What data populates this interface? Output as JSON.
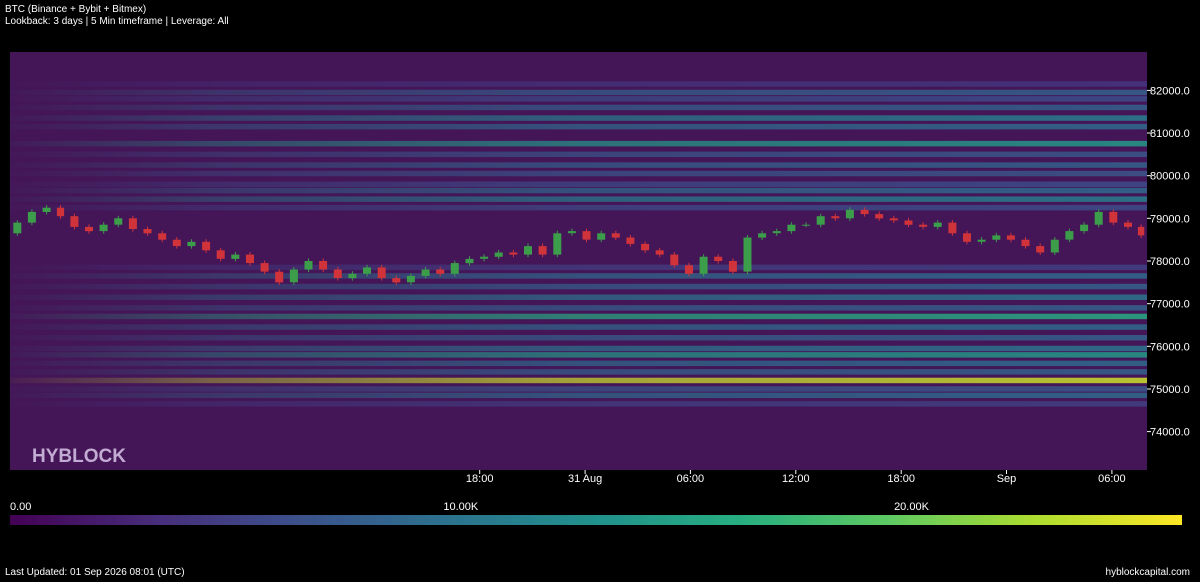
{
  "header": {
    "title": "BTC (Binance + Bybit + Bitmex)",
    "subtitle": "Lookback: 3 days | 5 Min timeframe | Leverage: All"
  },
  "footer": {
    "last_updated": "Last Updated: 01 Sep 2026 08:01 (UTC)",
    "site": "hyblockcapital.com"
  },
  "watermark": "HYBLOCK",
  "chart_data": {
    "type": "heatmap",
    "title": "",
    "xlabel": "",
    "ylabel": "",
    "x_tick_labels": [
      "18:00",
      "31 Aug",
      "06:00",
      "12:00",
      "18:00",
      "Sep",
      "06:00"
    ],
    "x_tick_times": [
      "2026-08-30 18:00",
      "2026-08-31 00:00",
      "2026-08-31 06:00",
      "2026-08-31 12:00",
      "2026-08-31 18:00",
      "2026-09-01 00:00",
      "2026-09-01 06:00"
    ],
    "x_range": [
      "2026-08-29 15:15",
      "2026-09-01 08:00"
    ],
    "y_ticks": [
      74000.0,
      75000.0,
      76000.0,
      77000.0,
      78000.0,
      79000.0,
      80000.0,
      81000.0,
      82000.0
    ],
    "y_tick_labels": [
      "74000.0",
      "75000.0",
      "76000.0",
      "77000.0",
      "78000.0",
      "79000.0",
      "80000.0",
      "81000.0",
      "82000.0"
    ],
    "ylim": [
      73100,
      82900
    ],
    "colorbar": {
      "min": 0,
      "max": 26000,
      "tick_values": [
        0,
        10000,
        20000
      ],
      "tick_labels": [
        "0.00",
        "10.00K",
        "20.00K"
      ],
      "colors": [
        "#440154",
        "#472d7b",
        "#3b528b",
        "#2c728e",
        "#21918c",
        "#28ae80",
        "#5ec962",
        "#addc30",
        "#fde725"
      ]
    },
    "background_color": "#441557",
    "liquidity_levels": [
      {
        "price": 82150,
        "value": 4000
      },
      {
        "price": 81950,
        "value": 8000
      },
      {
        "price": 81800,
        "value": 6000
      },
      {
        "price": 81600,
        "value": 8000
      },
      {
        "price": 81350,
        "value": 11000
      },
      {
        "price": 81150,
        "value": 9000
      },
      {
        "price": 80750,
        "value": 14000
      },
      {
        "price": 80500,
        "value": 7000
      },
      {
        "price": 80250,
        "value": 8000
      },
      {
        "price": 80050,
        "value": 7000
      },
      {
        "price": 79800,
        "value": 6000
      },
      {
        "price": 79650,
        "value": 9000
      },
      {
        "price": 79450,
        "value": 11000
      },
      {
        "price": 79250,
        "value": 6000
      },
      {
        "price": 77850,
        "value": 5000
      },
      {
        "price": 77650,
        "value": 9000
      },
      {
        "price": 77400,
        "value": 8000
      },
      {
        "price": 77150,
        "value": 10000
      },
      {
        "price": 76900,
        "value": 8000
      },
      {
        "price": 76700,
        "value": 16000
      },
      {
        "price": 76450,
        "value": 9000
      },
      {
        "price": 76200,
        "value": 8000
      },
      {
        "price": 75950,
        "value": 10000
      },
      {
        "price": 75800,
        "value": 14000
      },
      {
        "price": 75600,
        "value": 9000
      },
      {
        "price": 75400,
        "value": 8000
      },
      {
        "price": 75200,
        "value": 24000
      },
      {
        "price": 75000,
        "value": 7000
      },
      {
        "price": 74850,
        "value": 9000
      },
      {
        "price": 74650,
        "value": 5000
      }
    ],
    "price_series": {
      "name": "BTC",
      "times": [
        "2026-08-29 15:15",
        "2026-08-29 16:05",
        "2026-08-29 16:55",
        "2026-08-29 17:45",
        "2026-08-29 18:30",
        "2026-08-29 19:20",
        "2026-08-29 20:10",
        "2026-08-29 21:00",
        "2026-08-29 21:50",
        "2026-08-29 22:40",
        "2026-08-29 23:30",
        "2026-08-30 00:20",
        "2026-08-30 01:10",
        "2026-08-30 02:00",
        "2026-08-30 02:50",
        "2026-08-30 03:40",
        "2026-08-30 04:30",
        "2026-08-30 05:20",
        "2026-08-30 06:10",
        "2026-08-30 07:00",
        "2026-08-30 07:50",
        "2026-08-30 08:40",
        "2026-08-30 09:30",
        "2026-08-30 10:20",
        "2026-08-30 11:10",
        "2026-08-30 12:00",
        "2026-08-30 12:50",
        "2026-08-30 13:40",
        "2026-08-30 14:30",
        "2026-08-30 15:20",
        "2026-08-30 16:10",
        "2026-08-30 17:00",
        "2026-08-30 17:50",
        "2026-08-30 18:40",
        "2026-08-30 19:30",
        "2026-08-30 20:20",
        "2026-08-30 21:10",
        "2026-08-30 22:00",
        "2026-08-30 22:50",
        "2026-08-30 23:40",
        "2026-08-31 00:30",
        "2026-08-31 01:20",
        "2026-08-31 02:10",
        "2026-08-31 03:00",
        "2026-08-31 03:50",
        "2026-08-31 04:40",
        "2026-08-31 05:30",
        "2026-08-31 06:20",
        "2026-08-31 07:10",
        "2026-08-31 08:00",
        "2026-08-31 08:50",
        "2026-08-31 09:40",
        "2026-08-31 10:30",
        "2026-08-31 11:20",
        "2026-08-31 12:10",
        "2026-08-31 13:00",
        "2026-08-31 13:50",
        "2026-08-31 14:40",
        "2026-08-31 15:30",
        "2026-08-31 16:20",
        "2026-08-31 17:10",
        "2026-08-31 18:00",
        "2026-08-31 18:50",
        "2026-08-31 19:40",
        "2026-08-31 20:30",
        "2026-08-31 21:20",
        "2026-08-31 22:10",
        "2026-08-31 23:00",
        "2026-08-31 23:50",
        "2026-09-01 00:40",
        "2026-09-01 01:30",
        "2026-09-01 02:20",
        "2026-09-01 03:10",
        "2026-09-01 04:00",
        "2026-09-01 04:50",
        "2026-09-01 05:40",
        "2026-09-01 06:30",
        "2026-09-01 07:20",
        "2026-09-01 08:00"
      ],
      "values": [
        78650,
        78900,
        79150,
        79250,
        79050,
        78800,
        78700,
        78850,
        79000,
        78750,
        78650,
        78500,
        78350,
        78450,
        78250,
        78050,
        78150,
        77950,
        77750,
        77500,
        77800,
        78000,
        77800,
        77600,
        77700,
        77850,
        77600,
        77500,
        77650,
        77800,
        77700,
        77950,
        78050,
        78100,
        78200,
        78150,
        78350,
        78150,
        78650,
        78700,
        78500,
        78650,
        78550,
        78400,
        78250,
        78150,
        77900,
        77700,
        78100,
        78000,
        77750,
        78550,
        78650,
        78700,
        78850,
        78850,
        79050,
        79000,
        79200,
        79100,
        79000,
        78950,
        78850,
        78800,
        78900,
        78650,
        78450,
        78500,
        78600,
        78500,
        78350,
        78200,
        78500,
        78700,
        78850,
        79150,
        78900,
        78800,
        78600
      ]
    }
  }
}
